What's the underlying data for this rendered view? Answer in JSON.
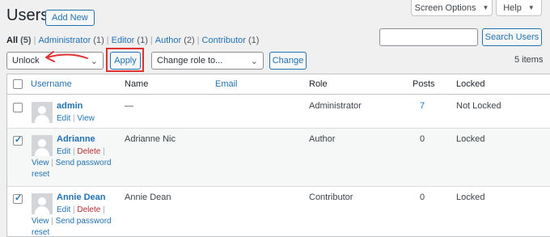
{
  "header": {
    "title": "Users",
    "add_new": "Add New",
    "screen_options": "Screen Options",
    "help": "Help"
  },
  "views": [
    {
      "label": "All",
      "count": "(5)",
      "current": true
    },
    {
      "label": "Administrator",
      "count": "(1)"
    },
    {
      "label": "Editor",
      "count": "(1)"
    },
    {
      "label": "Author",
      "count": "(2)"
    },
    {
      "label": "Contributor",
      "count": "(1)"
    }
  ],
  "search": {
    "placeholder": "",
    "button": "Search Users"
  },
  "bulk": {
    "selected": "Unlock",
    "apply": "Apply"
  },
  "role_change": {
    "selected": "Change role to...",
    "button": "Change"
  },
  "items_count": "5 items",
  "columns": {
    "username": "Username",
    "name": "Name",
    "email": "Email",
    "role": "Role",
    "posts": "Posts",
    "locked": "Locked"
  },
  "rows": [
    {
      "username": "admin",
      "name": "—",
      "role": "Administrator",
      "posts": "7",
      "locked": "Not Locked",
      "checked": false,
      "actions": {
        "edit": "Edit",
        "view": "View"
      }
    },
    {
      "username": "Adrianne",
      "name": "Adrianne Nic",
      "role": "Author",
      "posts": "0",
      "locked": "Locked",
      "checked": true,
      "actions": {
        "edit": "Edit",
        "delete": "Delete",
        "view": "View",
        "reset_line1": "Send password",
        "reset_line2": "reset"
      }
    },
    {
      "username": "Annie Dean",
      "name": "Annie Dean",
      "role": "Contributor",
      "posts": "0",
      "locked": "Locked",
      "checked": true,
      "actions": {
        "edit": "Edit",
        "delete": "Delete",
        "view": "View",
        "reset_line1": "Send password",
        "reset_line2": "reset"
      }
    }
  ],
  "colors": {
    "link": "#2271b1",
    "delete": "#b32d2e",
    "annotation": "#e03131"
  },
  "icons": {
    "dropdown": "chevron-down-icon",
    "checkbox": "checkbox-icon",
    "avatar": "default-avatar-icon",
    "annotation": "red-arrow-icon"
  }
}
